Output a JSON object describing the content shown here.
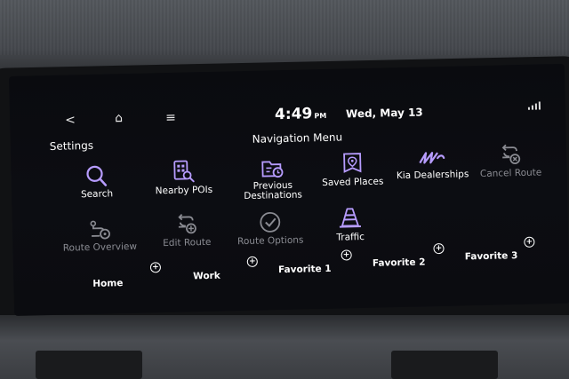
{
  "status_bar": {
    "back": "<",
    "home": "⌂",
    "menu": "≡",
    "time": "4:49",
    "ampm": "PM",
    "date": "Wed, May 13"
  },
  "header": {
    "settings_label": "Settings",
    "title": "Navigation Menu"
  },
  "menu_row1": [
    {
      "label": "Search",
      "icon": "search-icon",
      "enabled": true
    },
    {
      "label": "Nearby POIs",
      "icon": "nearby-poi-icon",
      "enabled": true
    },
    {
      "label": "Previous Destinations",
      "icon": "previous-destinations-icon",
      "enabled": true
    },
    {
      "label": "Saved Places",
      "icon": "saved-places-icon",
      "enabled": true
    },
    {
      "label": "Kia Dealerships",
      "icon": "kia-logo-icon",
      "enabled": true
    },
    {
      "label": "Cancel Route",
      "icon": "cancel-route-icon",
      "enabled": false
    }
  ],
  "menu_row2": [
    {
      "label": "Route Overview",
      "icon": "route-overview-icon",
      "enabled": false
    },
    {
      "label": "Edit Route",
      "icon": "edit-route-icon",
      "enabled": false
    },
    {
      "label": "Route Options",
      "icon": "route-options-icon",
      "enabled": false
    },
    {
      "label": "Traffic",
      "icon": "traffic-cone-icon",
      "enabled": true
    }
  ],
  "favorites": [
    {
      "label": "Home"
    },
    {
      "label": "Work"
    },
    {
      "label": "Favorite 1"
    },
    {
      "label": "Favorite 2"
    },
    {
      "label": "Favorite 3"
    }
  ],
  "colors": {
    "accent_purple": "#b79cff",
    "disabled_gray": "#8a8b92",
    "text_white": "#ffffff"
  }
}
